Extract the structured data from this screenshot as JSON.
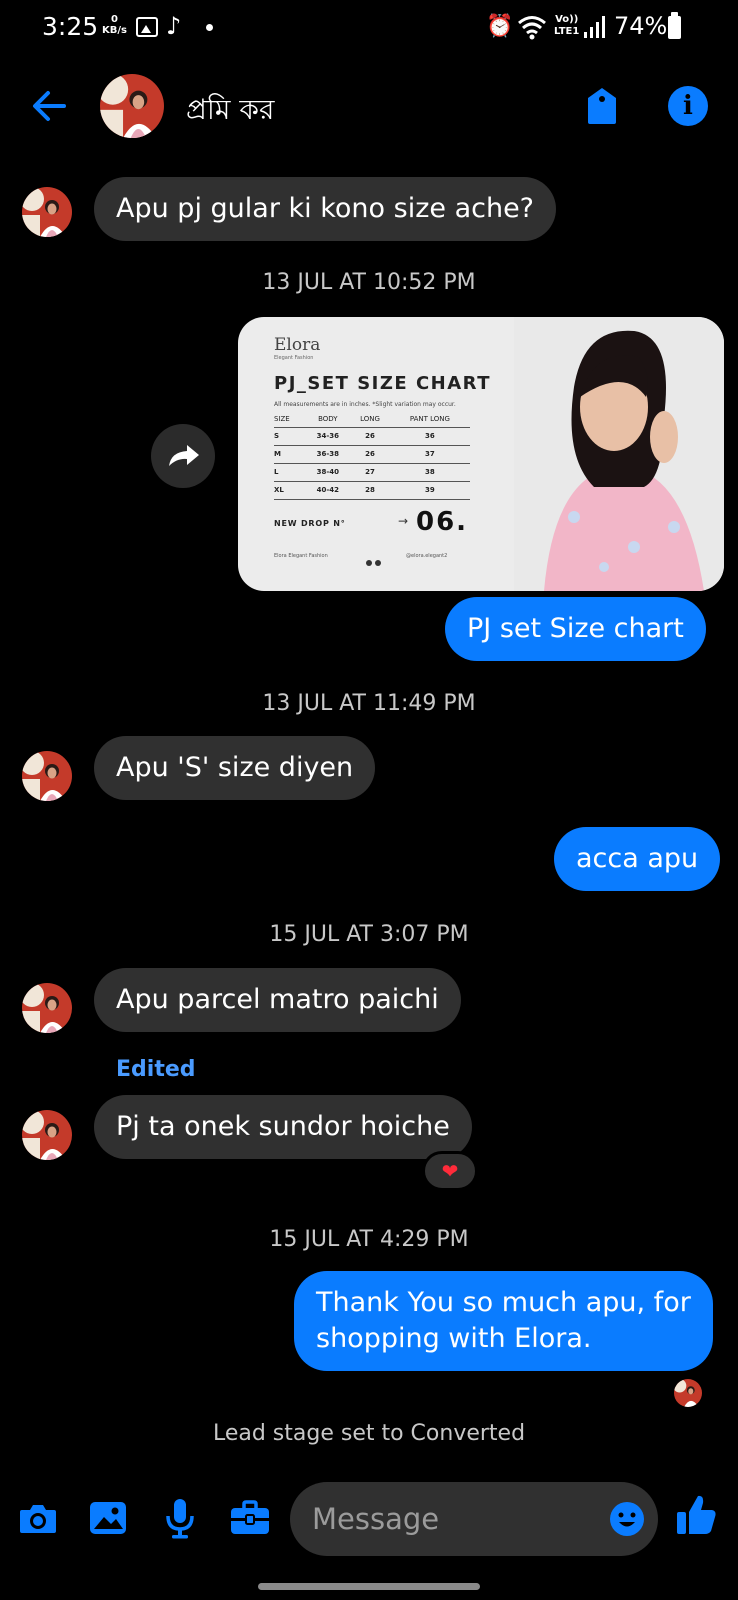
{
  "status_bar": {
    "time": "3:25",
    "net_speed_value": "0",
    "net_speed_unit": "KB/s",
    "lte_top": "Vo))",
    "lte_bottom": "LTE1",
    "battery": "74%"
  },
  "header": {
    "contact_name": "প্রমি কর"
  },
  "messages": [
    {
      "dir": "in",
      "text": "Apu pj gular ki kono size ache?"
    },
    {
      "timestamp": "13 JUL AT 10:52 PM"
    },
    {
      "dir": "out",
      "type": "image"
    },
    {
      "dir": "out",
      "text": "PJ set Size chart"
    },
    {
      "timestamp": "13 JUL AT 11:49 PM"
    },
    {
      "dir": "in",
      "text": "Apu 'S' size diyen"
    },
    {
      "dir": "out",
      "text": "acca apu"
    },
    {
      "timestamp": "15 JUL AT 3:07 PM"
    },
    {
      "dir": "in",
      "text": "Apu parcel matro paichi"
    },
    {
      "dir": "in",
      "edited_label": "Edited",
      "text": "Pj ta onek sundor hoiche",
      "reaction": "❤"
    },
    {
      "timestamp": "15 JUL AT 4:29 PM"
    },
    {
      "dir": "out",
      "lines": [
        "Thank You so much apu, for",
        "shopping with Elora."
      ]
    }
  ],
  "size_card": {
    "brand": "Elora",
    "brand_sub": "Elegant Fashion",
    "title": "PJ_SET SIZE CHART",
    "note": "All measurements are in inches. *Slight variation may occur.",
    "columns": [
      "SIZE",
      "BODY",
      "LONG",
      "PANT LONG"
    ],
    "rows": [
      [
        "S",
        "34-36",
        "26",
        "36"
      ],
      [
        "M",
        "36-38",
        "26",
        "37"
      ],
      [
        "L",
        "38-40",
        "27",
        "38"
      ],
      [
        "XL",
        "40-42",
        "28",
        "39"
      ]
    ],
    "new_drop_label": "NEW DROP N°",
    "drop_arrow": "→",
    "drop_number": "06.",
    "footer_left": "Elora Elegant Fashion",
    "footer_right": "@elora.elegant2"
  },
  "system_message": "Lead stage set to Converted",
  "composer": {
    "placeholder": "Message"
  },
  "colors": {
    "accent": "#0a7cff",
    "incoming_bubble": "#303030",
    "background": "#000000",
    "edited": "#4a9bff",
    "heart": "#ff2b3a"
  },
  "icons": {
    "back": "arrow-left-icon",
    "tag": "tag-icon",
    "info": "info-icon",
    "share": "share-icon",
    "camera": "camera-icon",
    "gallery": "image-icon",
    "mic": "microphone-icon",
    "briefcase": "briefcase-icon",
    "emoji": "smiley-icon",
    "like": "thumbs-up-icon"
  }
}
